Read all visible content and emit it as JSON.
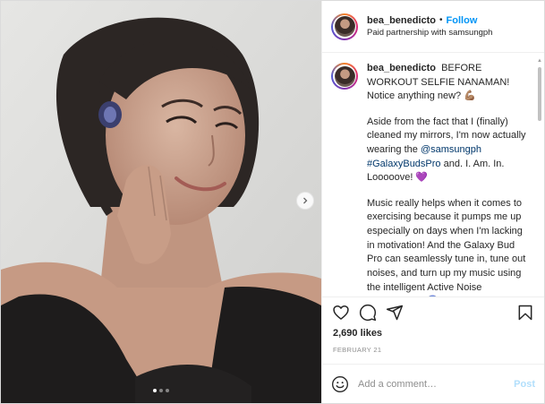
{
  "post": {
    "username": "bea_benedicto",
    "follow_label": "Follow",
    "bullet": "•",
    "partnership": "Paid partnership with samsungph"
  },
  "caption": {
    "username": "bea_benedicto",
    "p1_text": "BEFORE WORKOUT SELFIE NANAMAN! Notice anything new? 💪🏽",
    "p2_before": "Aside from the fact that I (finally) cleaned my mirrors, I'm now actually wearing the ",
    "mention": "@samsungph",
    "hashtag": "#GalaxyBudsPro",
    "p2_after": " and. I. Am. In. Looooove! 💜",
    "p3_text": "Music really helps when it comes to exercising because it pumps me up especially on days when I'm lacking in motivation! And the Galaxy Bud Pro can seamlessly tune in, tune out noises, and turn up my music using the intelligent Active Noise Cancellation! 😱 odiba! No more unnecessary noises when I'm busy exercising hihi!"
  },
  "engagement": {
    "likes": "2,690 likes",
    "date": "FEBRUARY 21"
  },
  "comment": {
    "placeholder": "Add a comment…",
    "post_label": "Post"
  },
  "carousel": {
    "count": 3,
    "active_index": 0
  },
  "icons": {
    "like": "heart-icon",
    "comment": "comment-icon",
    "share": "paper-plane-icon",
    "save": "bookmark-icon",
    "emoji": "smiley-icon",
    "next": "chevron-right-icon"
  },
  "colors": {
    "follow": "#0095f6",
    "link": "#00376b",
    "post_disabled": "#b2dffc",
    "muted": "#8e8e8e"
  }
}
